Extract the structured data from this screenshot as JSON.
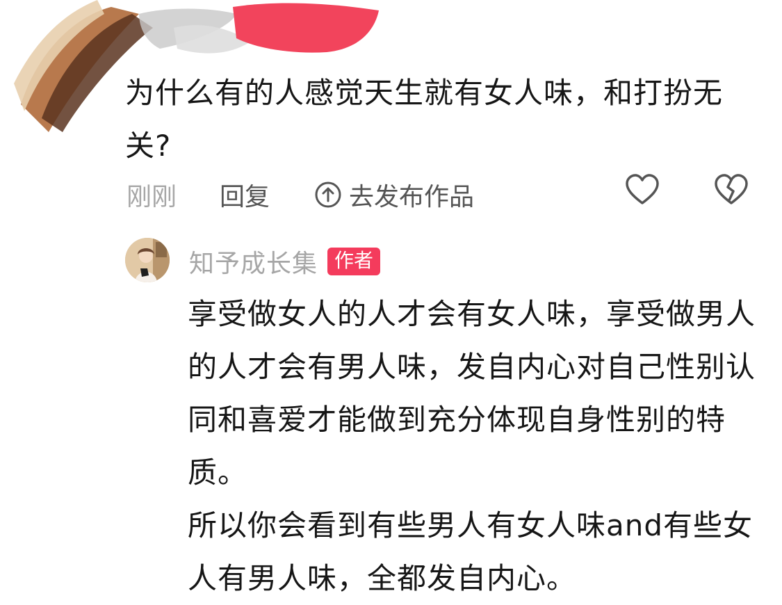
{
  "comment": {
    "question": "为什么有的人感觉天生就有女人味，和打扮无关?",
    "time": "刚刚",
    "reply_label": "回复",
    "publish_label": "去发布作品",
    "icons": {
      "publish": "upload-circle-icon",
      "like": "heart-icon",
      "dislike": "broken-heart-icon"
    }
  },
  "reply": {
    "author": "知予成长集",
    "badge": "作者",
    "paragraph1": "享受做女人的人才会有女人味，享受做男人的人才会有男人味，发自内心对自己性别认同和喜爱才能做到充分体现自身性别的特质。",
    "paragraph2": "所以你会看到有些男人有女人味and有些女人有男人味，全都发自内心。"
  },
  "colors": {
    "badge": "#f43b5c",
    "muted_text": "#a6a6a6",
    "action_text": "#555555",
    "main_text": "#161616"
  }
}
